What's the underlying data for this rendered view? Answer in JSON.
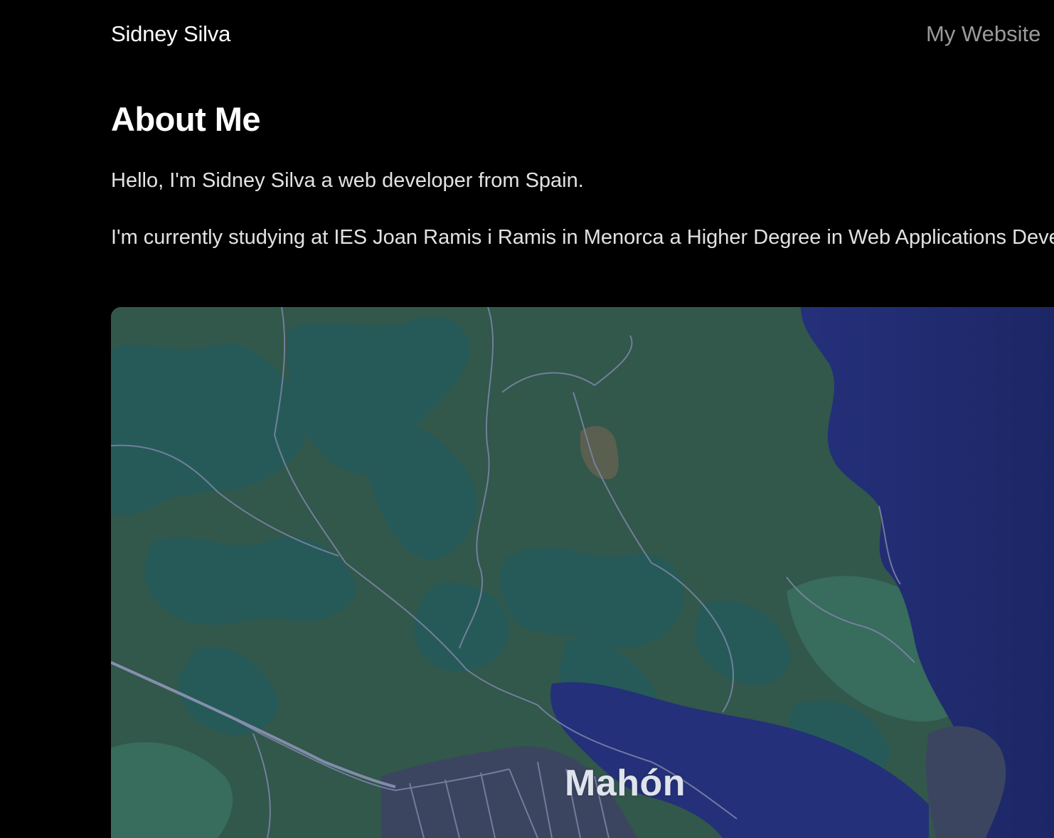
{
  "header": {
    "site_name": "Sidney Silva",
    "nav_link": "My Website"
  },
  "main": {
    "title": "About Me",
    "paragraphs": [
      "Hello, I'm Sidney Silva a web developer from Spain.",
      "I'm currently studying at IES Joan Ramis i Ramis in Menorca a Higher Degree in Web Applications Development. I also have a degree in Computer Systems and Networks."
    ]
  },
  "map": {
    "place_label": "Mahón",
    "colors": {
      "land": "#32574b",
      "forest": "#265a58",
      "sea": "#24307a",
      "deep_sea": "#1e2a6e",
      "urban": "#3b4560",
      "roads": "#7d86a8"
    }
  }
}
